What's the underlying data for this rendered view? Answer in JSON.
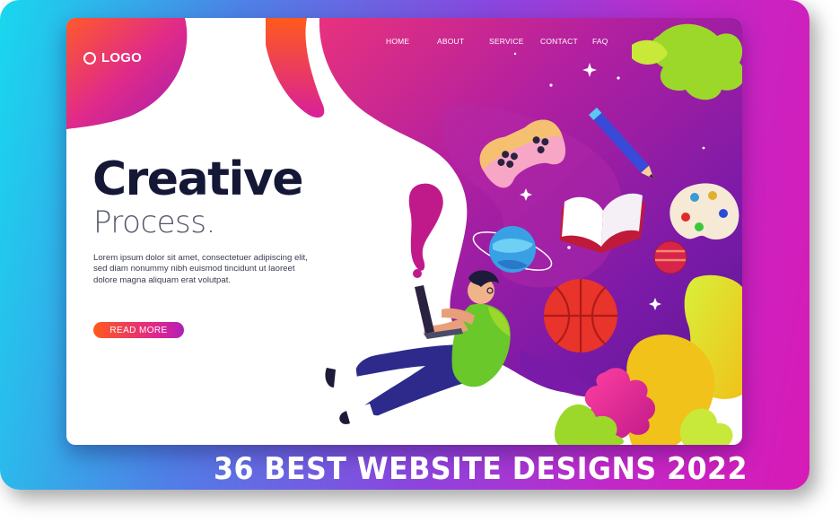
{
  "header": {
    "logo_text": "LOGO",
    "nav": [
      "HOME",
      "ABOUT",
      "SERVICE",
      "CONTACT",
      "FAQ"
    ]
  },
  "hero": {
    "title": "Creative",
    "subtitle": "Process.",
    "body": "Lorem ipsum dolor sit amet, consectetuer adipiscing elit, sed diam nonummy nibh euismod tincidunt ut laoreet dolore magna aliquam erat volutpat.",
    "cta_label": "READ MORE"
  },
  "banner": {
    "text": "36 BEST WEBSITE DESIGNS 2022"
  },
  "colors": {
    "brand_purple": "#8a1fa8",
    "brand_magenta": "#d8209a",
    "accent_orange": "#ff5a1c",
    "title_navy": "#141836"
  },
  "illustration": {
    "icons": [
      "gamepad-icon",
      "book-icon",
      "pencil-icon",
      "palette-icon",
      "planet-icon",
      "basketball-icon",
      "ball-icon",
      "sparkle-icon",
      "leaf-icon"
    ]
  }
}
